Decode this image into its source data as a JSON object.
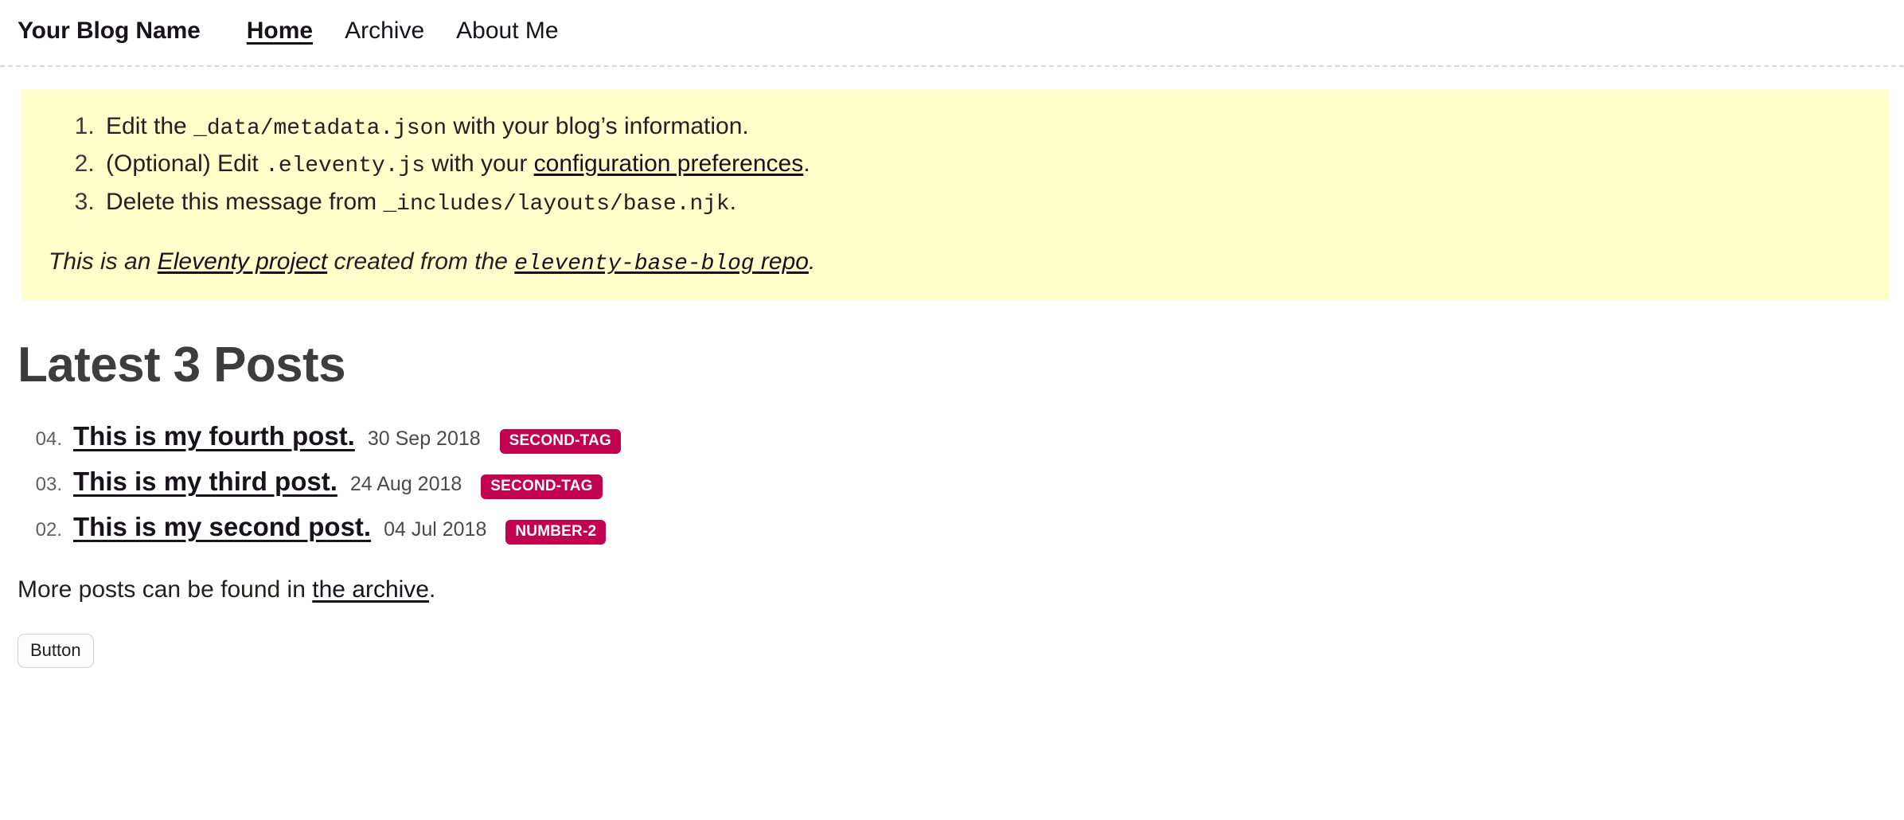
{
  "header": {
    "site_title": "Your Blog Name",
    "nav": [
      {
        "label": "Home",
        "active": true
      },
      {
        "label": "Archive",
        "active": false
      },
      {
        "label": "About Me",
        "active": false
      }
    ]
  },
  "notice": {
    "steps": [
      {
        "prefix": "Edit the ",
        "code": "_data/metadata.json",
        "suffix": " with your blog’s information."
      },
      {
        "prefix": "(Optional) Edit ",
        "code": ".eleventy.js",
        "mid": " with your ",
        "link": "configuration preferences",
        "suffix": "."
      },
      {
        "prefix": "Delete this message from ",
        "code": "_includes/layouts/base.njk",
        "suffix": "."
      }
    ],
    "credit": {
      "prefix": "This is an ",
      "link1": "Eleventy project",
      "mid": " created from the ",
      "link2_code": "eleventy-base-blog",
      "link2_text": " repo",
      "suffix": "."
    }
  },
  "main": {
    "section_title": "Latest 3 Posts",
    "posts": [
      {
        "number": "04.",
        "title": "This is my fourth post.",
        "date": "30 Sep 2018",
        "tags": [
          "second-tag"
        ]
      },
      {
        "number": "03.",
        "title": "This is my third post.",
        "date": "24 Aug 2018",
        "tags": [
          "second-tag"
        ]
      },
      {
        "number": "02.",
        "title": "This is my second post.",
        "date": "04 Jul 2018",
        "tags": [
          "number-2"
        ]
      }
    ],
    "archive_line": {
      "prefix": "More posts can be found in ",
      "link": "the archive",
      "suffix": "."
    },
    "button_label": "Button"
  },
  "colors": {
    "notice_background": "#ffffcc",
    "tag_background": "#c2024e",
    "tag_text": "#ffffff",
    "heading_text": "#3d3d3d",
    "body_text": "#23211f",
    "header_rule": "#d8d8d8"
  }
}
